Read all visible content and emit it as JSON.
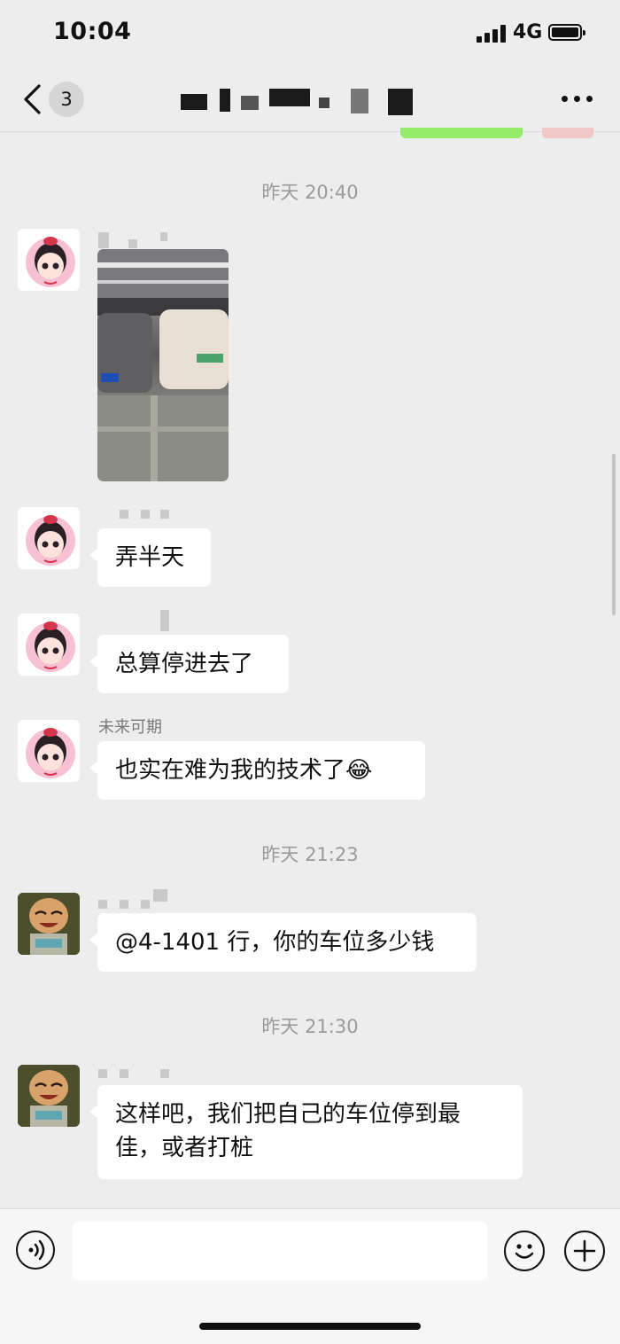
{
  "status_bar": {
    "time": "10:04",
    "network": "4G",
    "signal_icon": "signal-bars-icon",
    "battery_icon": "battery-icon"
  },
  "nav": {
    "back_icon": "chevron-left-icon",
    "unread_count": "3",
    "title_redacted": true,
    "more_icon": "more-dots-icon"
  },
  "colors": {
    "background": "#ededed",
    "bubble_in": "#ffffff",
    "bubble_out": "#95ec69",
    "timestamp": "#9a9a9a"
  },
  "messages": {
    "ts1": "昨天 20:40",
    "m1": {
      "type": "image",
      "sender_redacted": true,
      "avatar": "cartoon-girl-avatar"
    },
    "m2": {
      "text": "弄半天",
      "sender_redacted": true
    },
    "m3": {
      "text": "总算停进去了",
      "sender_redacted": true
    },
    "m4": {
      "sender": "未来可期",
      "text": "也实在难为我的技术了",
      "emoji": "😂"
    },
    "ts2": "昨天 21:23",
    "m5": {
      "text": "@4-1401 行，你的车位多少钱",
      "sender_redacted": true,
      "avatar": "laughing-kid-avatar"
    },
    "ts3": "昨天 21:30",
    "m6": {
      "line1": "这样吧，我们把自己的车位停到最",
      "line2": "佳，或者打桩",
      "sender_redacted": true
    }
  },
  "input_bar": {
    "voice_icon": "voice-icon",
    "emoji_icon": "emoji-icon",
    "plus_icon": "plus-icon",
    "text_value": ""
  }
}
